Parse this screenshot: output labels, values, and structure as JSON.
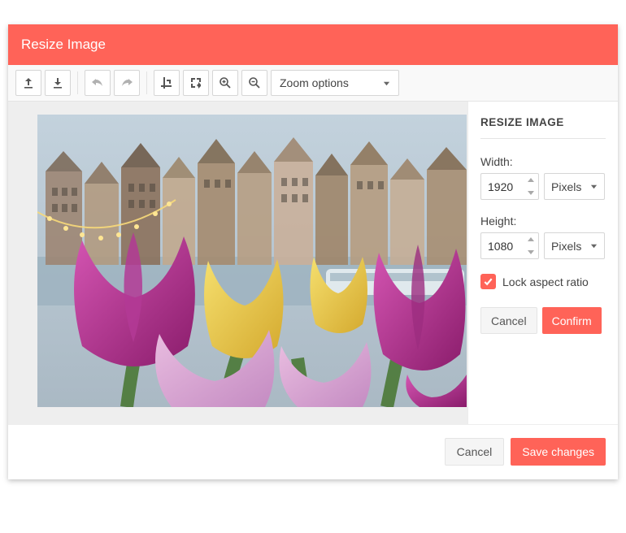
{
  "header": {
    "title": "Resize Image"
  },
  "toolbar": {
    "zoom_placeholder": "Zoom options"
  },
  "panel": {
    "heading": "RESIZE IMAGE",
    "width_label": "Width:",
    "width_value": "1920",
    "width_unit": "Pixels",
    "height_label": "Height:",
    "height_value": "1080",
    "height_unit": "Pixels",
    "lock_label": "Lock aspect ratio",
    "lock_checked": true,
    "cancel_label": "Cancel",
    "confirm_label": "Confirm"
  },
  "footer": {
    "cancel_label": "Cancel",
    "save_label": "Save changes"
  },
  "colors": {
    "accent": "#ff6358"
  }
}
